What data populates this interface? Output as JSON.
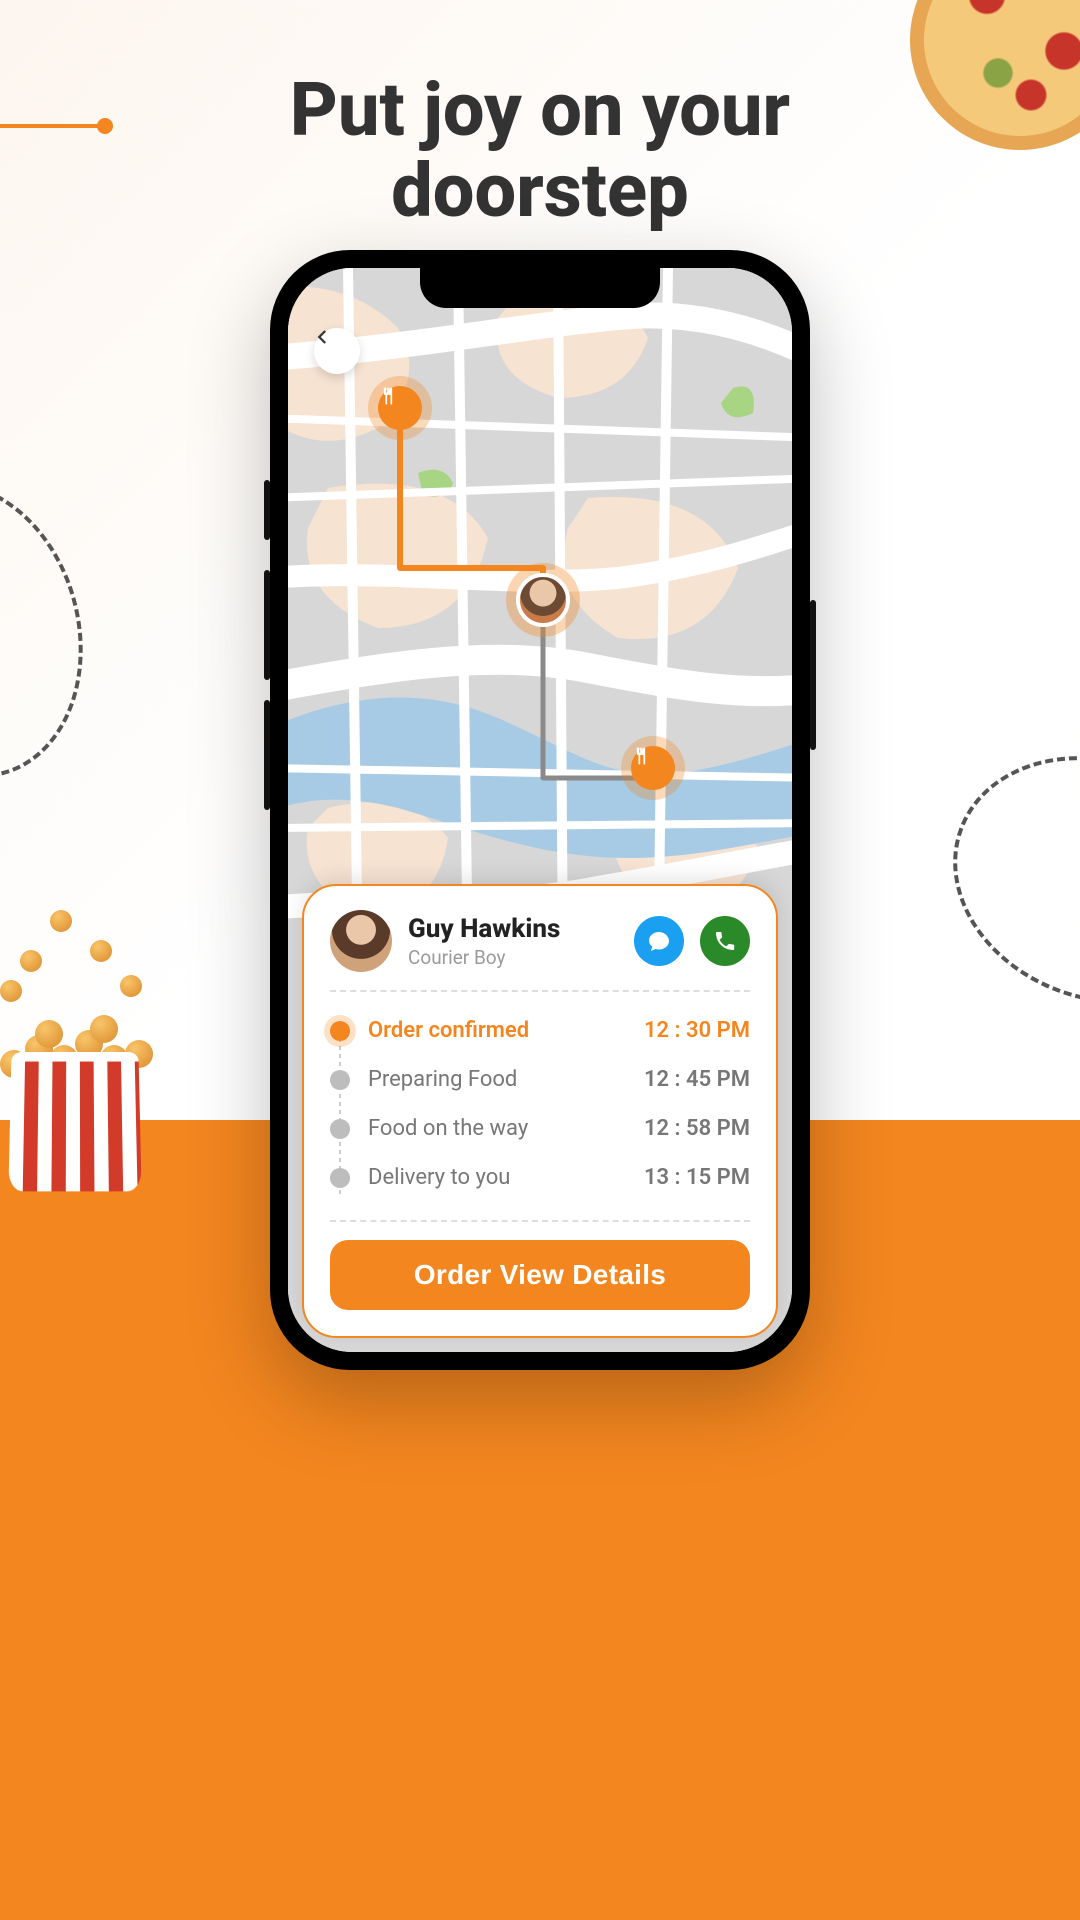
{
  "headline": {
    "line1": "Put joy on your",
    "line2": "doorstep"
  },
  "screen": {
    "back_aria": "Back",
    "pins": {
      "restaurant_icon": "utensils-icon",
      "destination_icon": "utensils-icon"
    }
  },
  "courier": {
    "name": "Guy Hawkins",
    "role": "Courier Boy",
    "actions": {
      "chat": "Chat",
      "call": "Call"
    }
  },
  "timeline": [
    {
      "label": "Order confirmed",
      "time": "12 : 30 PM",
      "active": true
    },
    {
      "label": "Preparing Food",
      "time": "12 : 45 PM",
      "active": false
    },
    {
      "label": "Food on the way",
      "time": "12 : 58 PM",
      "active": false
    },
    {
      "label": "Delivery to you",
      "time": "13 : 15 PM",
      "active": false
    }
  ],
  "cta": {
    "details": "Order View Details"
  },
  "colors": {
    "accent": "#f3861f"
  }
}
